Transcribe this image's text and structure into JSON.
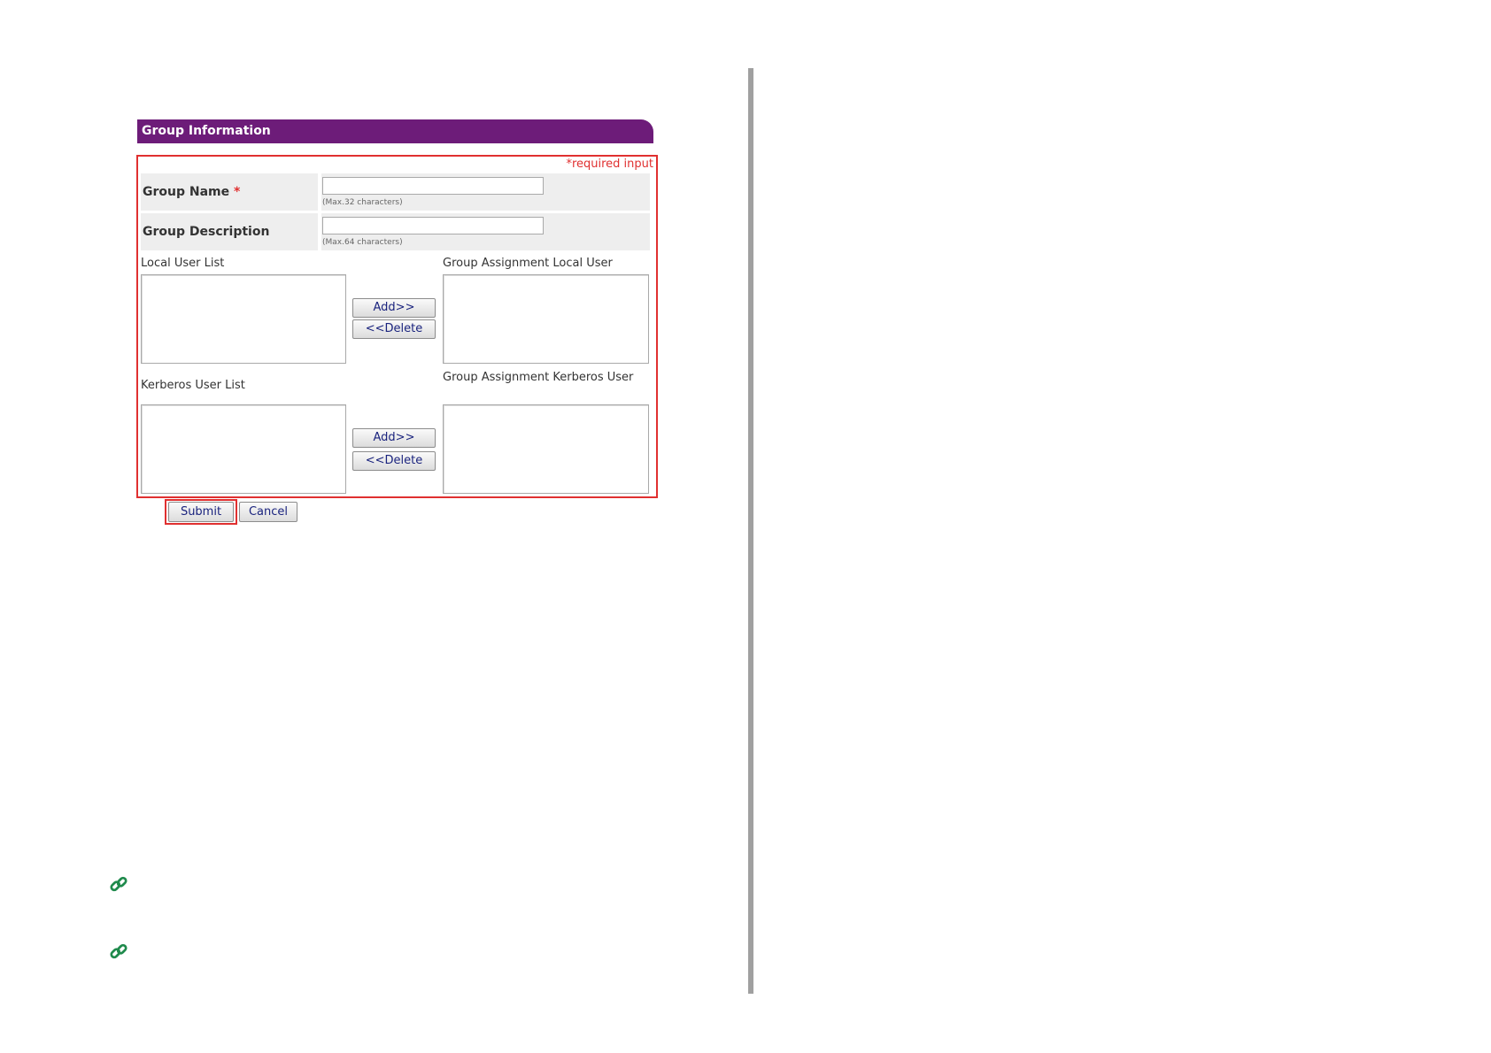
{
  "panel": {
    "title": "Group Information",
    "required_note": "*required input"
  },
  "fields": {
    "group_name": {
      "label": "Group Name",
      "required_mark": "*",
      "value": "",
      "hint": "(Max.32 characters)"
    },
    "group_description": {
      "label": "Group Description",
      "value": "",
      "hint": "(Max.64 characters)"
    }
  },
  "local": {
    "list_label": "Local User List",
    "assignment_label": "Group Assignment Local User",
    "add_label": "Add>>",
    "delete_label": "<<Delete"
  },
  "kerberos": {
    "list_label": "Kerberos User List",
    "assignment_label": "Group Assignment Kerberos User",
    "add_label": "Add>>",
    "delete_label": "<<Delete"
  },
  "actions": {
    "submit_label": "Submit",
    "cancel_label": "Cancel"
  },
  "colors": {
    "title_bar": "#6d1c79",
    "highlight": "#e03030",
    "link_icon": "#1f8a4c"
  },
  "icons": [
    "link-icon",
    "link-icon"
  ]
}
